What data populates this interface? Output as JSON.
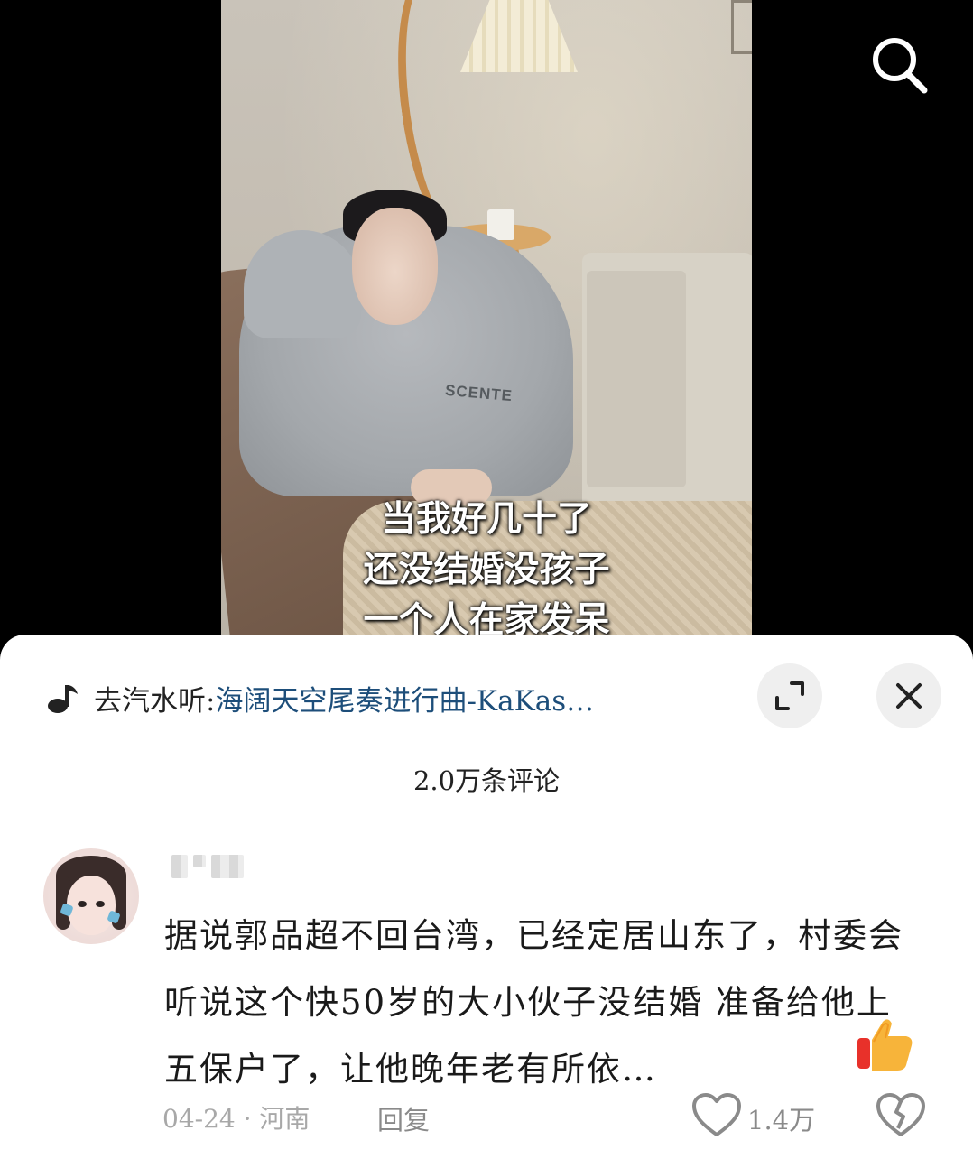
{
  "video": {
    "subtitles": [
      "当我好几十了",
      "还没结婚没孩子",
      "一个人在家发呆"
    ],
    "hoodie_print": "SCENTE"
  },
  "top_bar": {
    "search_icon": "search-icon"
  },
  "comments_sheet": {
    "music": {
      "icon": "music-note-icon",
      "prefix": "去汽水听:",
      "title": "海阔天空尾奏进行曲-KaKas…"
    },
    "expand_icon": "expand-icon",
    "close_icon": "close-icon",
    "comment_count": "2.0万条评论",
    "comments": [
      {
        "avatar": "avatar",
        "text": "据说郭品超不回台湾，已经定居山东了，村委会听说这个快50岁的大小伙子没结婚 准备给他上五保户了，让他晚年老有所依…",
        "emoji": "thumbs-up-icon",
        "date_location": "04-24 · 河南",
        "reply_label": "回复",
        "like_count": "1.4万"
      }
    ]
  },
  "colors": {
    "link_blue": "#1d4e7a",
    "meta_gray": "#a8a8a8",
    "sheet_bg": "#ffffff"
  }
}
